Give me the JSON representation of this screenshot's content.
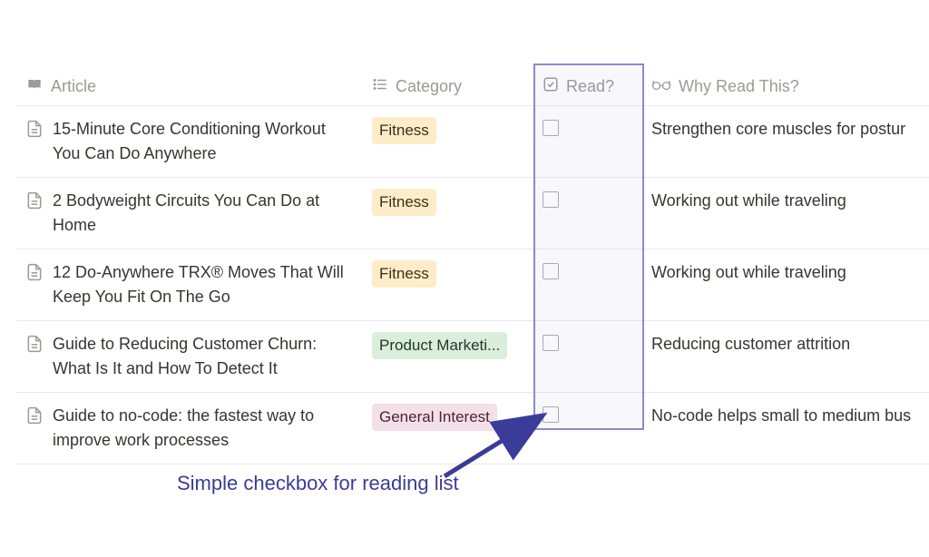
{
  "columns": {
    "article": "Article",
    "category": "Category",
    "read": "Read?",
    "why": "Why Read This?"
  },
  "rows": [
    {
      "article": "15-Minute Core Conditioning Workout You Can Do Anywhere",
      "category": "Fitness",
      "categoryClass": "tag-fitness",
      "read": false,
      "why": "Strengthen core muscles for postur"
    },
    {
      "article": "2 Bodyweight Circuits You Can Do at Home",
      "category": "Fitness",
      "categoryClass": "tag-fitness",
      "read": false,
      "why": "Working out while traveling"
    },
    {
      "article": "12 Do-Anywhere TRX® Moves That Will Keep You Fit On The Go",
      "category": "Fitness",
      "categoryClass": "tag-fitness",
      "read": false,
      "why": "Working out while traveling"
    },
    {
      "article": "Guide to Reducing Customer Churn: What Is It and How To Detect It",
      "category": "Product Marketi...",
      "categoryClass": "tag-product",
      "read": false,
      "why": "Reducing customer attrition"
    },
    {
      "article": "Guide to no-code: the fastest way to improve work processes",
      "category": "General Interest",
      "categoryClass": "tag-general",
      "read": false,
      "why": "No-code helps small to medium bus"
    }
  ],
  "annotation": "Simple checkbox for reading list"
}
